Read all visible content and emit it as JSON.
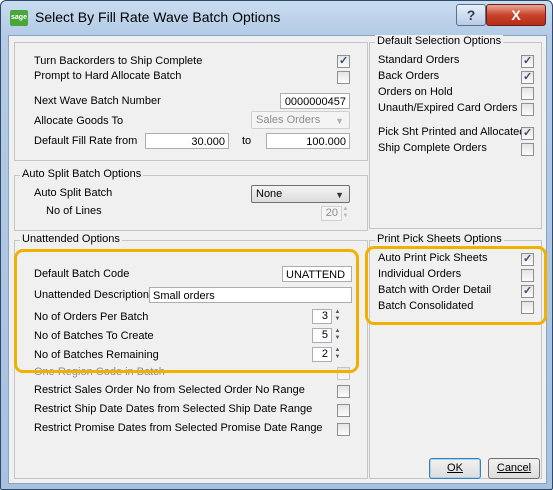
{
  "window": {
    "logo_text": "sage",
    "title": "Select By Fill Rate Wave Batch Options",
    "help_glyph": "?",
    "close_glyph": "X"
  },
  "main": {
    "turn_backorders_label": "Turn Backorders to Ship Complete",
    "turn_backorders_checked": true,
    "prompt_hard_allocate_label": "Prompt to Hard Allocate Batch",
    "prompt_hard_allocate_checked": false,
    "next_wave_label": "Next Wave Batch Number",
    "next_wave_value": "0000000457",
    "allocate_goods_label": "Allocate Goods To",
    "allocate_goods_value": "Sales Orders",
    "default_fill_label": "Default Fill Rate from",
    "fill_from_value": "30.000",
    "to_label": "to",
    "fill_to_value": "100.000"
  },
  "default_selection": {
    "title": "Default Selection Options",
    "items": [
      {
        "label": "Standard Orders",
        "checked": true
      },
      {
        "label": "Back Orders",
        "checked": true
      },
      {
        "label": "Orders on Hold",
        "checked": false
      },
      {
        "label": "Unauth/Expired Card Orders",
        "checked": false
      },
      {
        "label": "Pick Sht Printed and Allocated",
        "checked": true
      },
      {
        "label": "Ship Complete Orders",
        "checked": false
      }
    ]
  },
  "auto_split": {
    "title": "Auto Split Batch Options",
    "batch_label": "Auto Split Batch",
    "batch_value": "None",
    "lines_label": "No of Lines",
    "lines_value": "20"
  },
  "unattended": {
    "title": "Unattended Options",
    "batch_code_label": "Default Batch Code",
    "batch_code_value": "UNATTEND",
    "description_label": "Unattended Description",
    "description_value": "Small orders",
    "orders_per_batch_label": "No of Orders Per Batch",
    "orders_per_batch_value": "3",
    "batches_create_label": "No of Batches To Create",
    "batches_create_value": "5",
    "batches_remaining_label": "No of Batches Remaining",
    "batches_remaining_value": "2",
    "one_region_label": "One Region Code in Batch",
    "restrict_sales_label": "Restrict Sales Order No from Selected Order No Range",
    "restrict_ship_label": "Restrict Ship Date Dates from Selected Ship Date Range",
    "restrict_promise_label": "Restrict Promise Dates from Selected Promise Date Range"
  },
  "print_pick": {
    "title": "Print Pick Sheets Options",
    "items": [
      {
        "label": "Auto Print Pick Sheets",
        "checked": true
      },
      {
        "label": "Individual Orders",
        "checked": false
      },
      {
        "label": "Batch with Order Detail",
        "checked": true
      },
      {
        "label": "Batch Consolidated",
        "checked": false
      }
    ]
  },
  "buttons": {
    "ok_label": "OK",
    "cancel_label": "Cancel"
  },
  "colors": {
    "highlight": "#f0b000",
    "title_bar": "#b3cbe6",
    "close_red": "#c8432c"
  }
}
